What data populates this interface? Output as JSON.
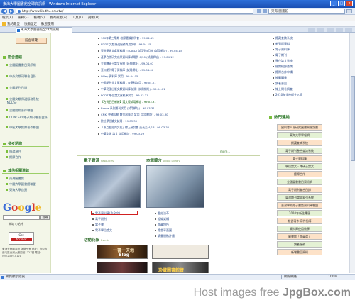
{
  "window": {
    "title": "東海大學圖書館全球資訊網 - Windows Internet Explorer",
    "controls": [
      "_",
      "□",
      "x"
    ]
  },
  "address": {
    "url": "http://www.lib.thu.edu.tw/",
    "search_value": "東海 圖書館"
  },
  "menu": [
    "檔案(F)",
    "編輯(E)",
    "檢視(V)",
    "我的最愛(A)",
    "工具(T)",
    "說明(H)"
  ],
  "favorites": [
    "我的最愛",
    "快顯設定",
    "歡迎使用"
  ],
  "tab": {
    "label": "東海大學圖書館全球資訊網"
  },
  "sidebar": {
    "top_button": "館舍導覽",
    "sections": [
      {
        "title": "館合連結",
        "items": [
          "全國圖書書目資訊網",
          "中外文期刊聯合目錄",
          "全國期刊目錄",
          "全國文獻傳遞服務系統(NDDS)",
          "全國館際合作聯盟",
          "CONCERT電子期刊聯合目錄",
          "中區大學館際合作聯盟"
        ]
      },
      {
        "title": "參考諮詢",
        "items": [
          "服務項目",
          "館際合作"
        ]
      },
      {
        "title": "其他相關連結",
        "items": [
          "東海圖書館",
          "中國大學圖書館聯盟",
          "東海大學首頁"
        ]
      }
    ],
    "google": {
      "letters": [
        "G",
        "o",
        "o",
        "g",
        "l",
        "e"
      ],
      "button": "搜尋",
      "radio": "本站  ○站外"
    },
    "acrobat": [
      "Get",
      "Acrobat"
    ],
    "footer": "東海大學圖書館 版權所有 地址：台中市西屯區台灣大道四段1727號 電話：(04)2359-0121"
  },
  "news": [
    "100年第三學期 校際選課說明會 - 99.04.15",
    "EDDS 文獻傳遞服務費用說明 - 99.04.15",
    "臺灣學術文獻資料庫 (TAARD) 試用到5月底 (試用網址) - 99.04.13",
    "產學合作研究成果資料庫試用到 6/30 (試用網址) - 99.04.12",
    "全國博碩士論文系統 (延伸網址) - 99.04.07",
    "亞洲期刊電子資料庫 (試用網址) - 99.04.06",
    "Wiley 資料庫 試用 - 99.04.05",
    "中國期刊全文資料庫 - 各學科試用 - 99.04.01",
    "中華民國出版文獻資料庫 試用 (試用網址) - 99.04.01",
    "PQDT 學位論文資料庫試用 - 99.03.31",
    "【台灣日日新報】漢文版試用網址 - 99.03.31",
    "Bonus 系列期刊試用 (試用網址) - 99.03.31",
    "CNKI 中國知網 數位出版品 試用 (試用網址) - 99.03.30",
    "數位學位論文試用 - 99.03.30",
    "「東亞歷史與文化」線上研討會 延長至 4/18 - 99.03.30",
    "中華文化 論文 試用網址 - 99.03.29"
  ],
  "news_more": "more...",
  "resources": {
    "title": "電子資源",
    "title_en": "Resources",
    "links": [
      "電子資料庫(含全文)",
      "電子期刊",
      "電子書",
      "電子學位論文"
    ]
  },
  "about": {
    "title": "本館簡介",
    "title_en": "About Library",
    "links": [
      "歷史沿革",
      "組織架構",
      "館藏特色",
      "館舍平面圖",
      "讀書服務計畫"
    ]
  },
  "events": {
    "title": "活動花絮",
    "title_en": "Events"
  },
  "banners": [
    "一書一天地",
    "Blog",
    "",
    "珍藏圖書館資"
  ],
  "right_links": [
    "館藏查詢系統",
    "新到館資料",
    "電子資料庫",
    "電子期刊",
    "學位論文系統",
    "借閱紀錄查詢",
    "館際合作申請",
    "推薦購書",
    "讀者意見",
    "線上問卷調查",
    "2010年全校師生入館"
  ],
  "right_section": {
    "title": "熱門連結"
  },
  "right_buttons": [
    {
      "label": "國科會人社研究圖書資源計畫",
      "color": "#fde2c8"
    },
    {
      "label": "東海大學學報網",
      "color": "#e4f1d4"
    },
    {
      "label": "館藏查詢系統",
      "color": "#fde2c8"
    },
    {
      "label": "電子期刊整合查詢系統",
      "color": "#e4f1d4"
    },
    {
      "label": "電子資料庫",
      "color": "#fde2c8"
    },
    {
      "label": "學位論文 - 博碩士論文",
      "color": "#e4f1d4"
    },
    {
      "label": "館際合作",
      "color": "#fde2c8"
    },
    {
      "label": "全國圖書書目資訊網",
      "color": "#e4f1d4"
    },
    {
      "label": "電子期刊聯合目錄",
      "color": "#fde2c8"
    },
    {
      "label": "臺灣期刊論文索引系統",
      "color": "#e4f1d4"
    },
    {
      "label": "台灣學術電子書暨資料庫聯盟",
      "color": "#fde2c8"
    },
    {
      "label": "2010年新生專區",
      "color": "#e4f1d4"
    },
    {
      "label": "報告寫作 寫作指導",
      "color": "#fde2c8"
    },
    {
      "label": "資料庫使用教學",
      "color": "#e4f1d4"
    },
    {
      "label": "圖書館「館員選」",
      "color": "#fde2c8"
    },
    {
      "label": "讀者服務",
      "color": "#e4f1d4"
    },
    {
      "label": "新增書目資料",
      "color": "#fde2c8"
    }
  ],
  "status": {
    "left": "網頁顯示錯誤",
    "zone": "網際網路",
    "zoom": "100%"
  },
  "watermark": {
    "prefix": "Host images free ",
    "brand": "JpgBox.com"
  }
}
